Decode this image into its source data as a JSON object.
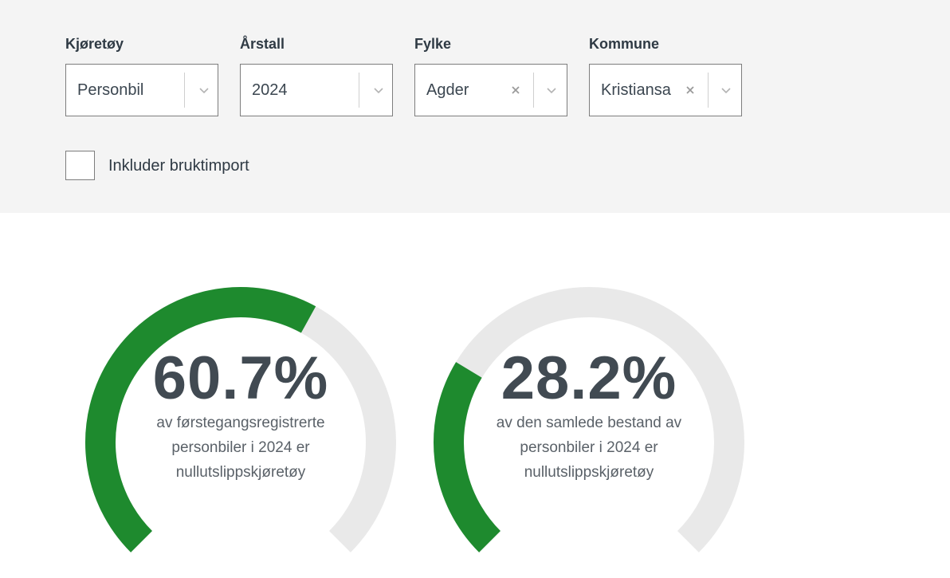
{
  "filters": {
    "vehicle": {
      "label": "Kjøretøy",
      "value": "Personbil"
    },
    "year": {
      "label": "Årstall",
      "value": "2024"
    },
    "county": {
      "label": "Fylke",
      "value": "Agder"
    },
    "municipality": {
      "label": "Kommune",
      "value": "Kristiansa"
    }
  },
  "checkbox": {
    "label": "Inkluder bruktimport",
    "checked": false
  },
  "gauges": [
    {
      "value": "60.7%",
      "fraction": 0.607,
      "description": "av førstegangsregistrerte personbiler i 2024 er nullutslippskjøretøy"
    },
    {
      "value": "28.2%",
      "fraction": 0.282,
      "description": "av den samlede bestand av personbiler i 2024 er nullutslippskjøretøy"
    }
  ],
  "colors": {
    "accent": "#1e8a2e",
    "track": "#e9e9e9",
    "panel": "#f4f4f4"
  }
}
